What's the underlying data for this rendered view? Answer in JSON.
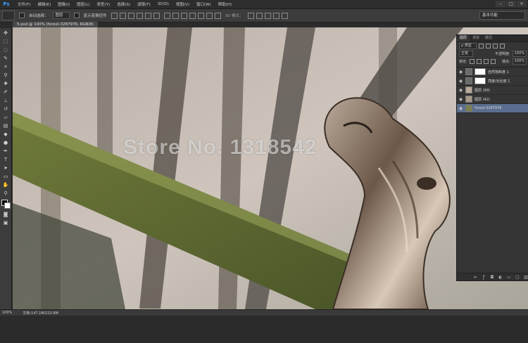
{
  "menu": {
    "logo": "Ps",
    "items": [
      "文件(F)",
      "编辑(E)",
      "图像(I)",
      "图层(L)",
      "类型(Y)",
      "选择(S)",
      "滤镜(T)",
      "3D(D)",
      "视图(V)",
      "窗口(W)",
      "帮助(H)"
    ],
    "minimize": "–",
    "restore": "□",
    "close": "×"
  },
  "options": {
    "auto_select_label": "自动选择：",
    "auto_select_value": "图层",
    "show_transform_label": "显示变换控件",
    "mode_label": "3D 模式：",
    "workspace": "基本功能"
  },
  "document": {
    "tab_title": "5.psd @ 100% (forest-3287976, RGB/8)",
    "watermark": "Store No. 1318542"
  },
  "status": {
    "zoom": "100%",
    "doc_info": "文档:147.1M/223.8M"
  },
  "layers_panel": {
    "tabs": [
      "图层",
      "通道",
      "路径"
    ],
    "filter_type": "ρ 类型",
    "blend_mode": "正常",
    "opacity_label": "不透明度:",
    "opacity_value": "100%",
    "lock_label": "锁定:",
    "fill_label": "填充:",
    "fill_value": "100%",
    "layers": [
      {
        "name": "自然饱和度 1",
        "selected": false
      },
      {
        "name": "亮度/对比度 1",
        "selected": false
      },
      {
        "name": "图层 (99)",
        "selected": false
      },
      {
        "name": "图层 (42)",
        "selected": false
      },
      {
        "name": "forest-3287976",
        "selected": true
      }
    ]
  },
  "colors": {
    "accent": "#3aa0ff",
    "selected_layer": "#5a6e8f",
    "panel_bg": "#353535"
  }
}
